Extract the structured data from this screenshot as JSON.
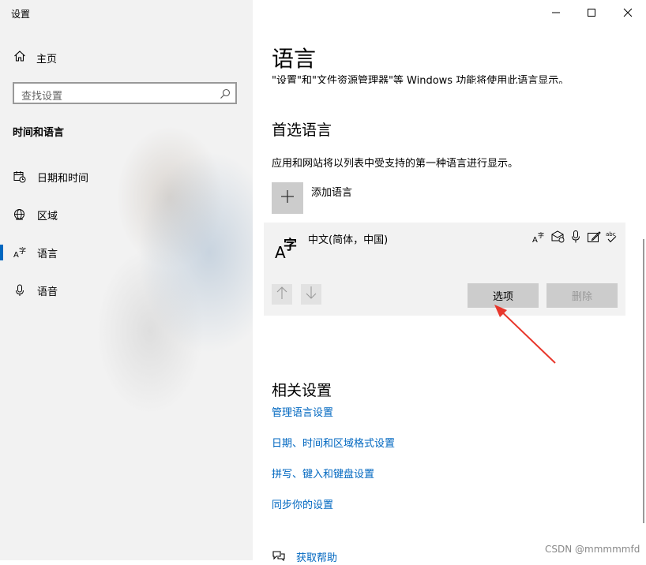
{
  "window": {
    "title": "设置",
    "minimize_icon": "minimize-icon",
    "maximize_icon": "maximize-icon",
    "close_icon": "close-icon"
  },
  "sidebar": {
    "home_label": "主页",
    "search_placeholder": "查找设置",
    "section_title": "时间和语言",
    "items": [
      {
        "label": "日期和时间",
        "icon": "calendar-clock-icon"
      },
      {
        "label": "区域",
        "icon": "globe-icon"
      },
      {
        "label": "语言",
        "icon": "language-icon",
        "selected": true
      },
      {
        "label": "语音",
        "icon": "microphone-icon"
      }
    ]
  },
  "main": {
    "title": "语言",
    "clipped_text": "\"设置\"和\"文件资源管理器\"等 Windows 功能将使用此语言显示。",
    "preferred": {
      "heading": "首选语言",
      "description": "应用和网站将以列表中受支持的第一种语言进行显示。",
      "add_label": "添加语言",
      "languages": [
        {
          "name": "中文(简体，中国)",
          "icon_glyph_a": "A",
          "icon_glyph_zi": "字",
          "features": [
            "display-language-icon",
            "speech-icon",
            "microphone-icon",
            "handwriting-icon",
            "spellcheck-icon"
          ],
          "options_label": "选项",
          "remove_label": "删除"
        }
      ]
    },
    "related": {
      "heading": "相关设置",
      "links": [
        "管理语言设置",
        "日期、时间和区域格式设置",
        "拼写、键入和键盘设置",
        "同步你的设置"
      ]
    },
    "help_label": "获取帮助"
  },
  "watermark": "CSDN @mmmmmfd",
  "colors": {
    "accent": "#0067c0",
    "sidebar_bg": "#f2f2f2",
    "card_bg": "#f2f2f2",
    "button_bg": "#cccccc",
    "annotation_arrow": "#e8372c"
  }
}
